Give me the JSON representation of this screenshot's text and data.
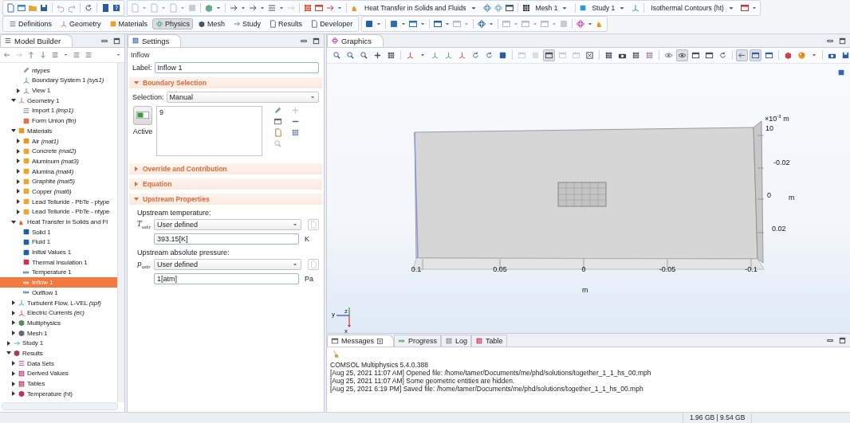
{
  "toolbar": {
    "dropdowns": [
      "Heat Transfer in Solids and Fluids",
      "Mesh 1",
      "Study 1",
      "Isothermal Contours (ht)"
    ]
  },
  "ribbon": {
    "tabs": [
      {
        "label": "Definitions",
        "selected": false
      },
      {
        "label": "Geometry",
        "selected": false
      },
      {
        "label": "Materials",
        "selected": false
      },
      {
        "label": "Physics",
        "selected": true
      },
      {
        "label": "Mesh",
        "selected": false
      },
      {
        "label": "Study",
        "selected": false
      },
      {
        "label": "Results",
        "selected": false
      },
      {
        "label": "Developer",
        "selected": false
      }
    ]
  },
  "model_builder": {
    "title": "Model Builder",
    "tree": [
      {
        "children": [
          {
            "children": [
              {
                "label": "ntypes",
                "kind": "selection",
                "selected": false
              },
              {
                "label": "Boundary System 1 *(sys1)*",
                "kind": "coordinate",
                "selected": false
              },
              {
                "label": "View 1",
                "kind": "view",
                "expanded": false,
                "selected": false
              }
            ]
          },
          {
            "label": "Geometry 1",
            "kind": "geometry",
            "expanded": true,
            "selected": false,
            "children": [
              {
                "label": "Import 1 *(imp1)*",
                "kind": "import",
                "selected": false
              },
              {
                "label": "Form Union *(fin)*",
                "kind": "union",
                "selected": false
              }
            ]
          },
          {
            "label": "Materials",
            "kind": "materials",
            "expanded": true,
            "selected": false,
            "children": [
              {
                "label": "Air *(mat1)*",
                "kind": "materials",
                "expanded": false,
                "selected": false
              },
              {
                "label": "Concrete *(mat2)*",
                "kind": "material",
                "expanded": false,
                "selected": false
              },
              {
                "label": "Aluminum *(mat3)*",
                "kind": "material",
                "expanded": false,
                "selected": false
              },
              {
                "label": "Alumina *(mat4)*",
                "kind": "material",
                "expanded": false,
                "selected": false
              },
              {
                "label": "Graphite *(mat5)*",
                "kind": "material",
                "expanded": false,
                "selected": false
              },
              {
                "label": "Copper *(mat6)*",
                "kind": "material",
                "expanded": false,
                "selected": false
              },
              {
                "label": "Lead Telluride - PbTe - ptype",
                "kind": "material",
                "expanded": false,
                "selected": false
              },
              {
                "label": "Lead Telluride - PbTe - ntype",
                "kind": "material",
                "expanded": false,
                "selected": false
              }
            ]
          },
          {
            "label": "Heat Transfer in Solids and Fl",
            "kind": "physics",
            "expanded": true,
            "selected": false,
            "children": [
              {
                "label": "Solid 1",
                "kind": "domain",
                "selected": false
              },
              {
                "label": "Fluid 1",
                "kind": "domain",
                "selected": false
              },
              {
                "label": "Initial Values 1",
                "kind": "domain",
                "selected": false
              },
              {
                "label": "Thermal Insulation 1",
                "kind": "insulation",
                "selected": false
              },
              {
                "label": "Temperature 1",
                "kind": "boundary",
                "selected": false
              },
              {
                "label": "Inflow 1",
                "kind": "boundary",
                "selected": true
              },
              {
                "label": "Outflow 1",
                "kind": "boundary",
                "selected": false
              }
            ]
          },
          {
            "label": "Turbulent Flow, L-VEL *(spf)*",
            "kind": "flow",
            "expanded": false,
            "selected": false
          },
          {
            "label": "Electric Currents *(ec)*",
            "kind": "electric",
            "expanded": false,
            "selected": false
          },
          {
            "label": "Multiphysics",
            "kind": "multiphysics",
            "expanded": false,
            "selected": false
          },
          {
            "label": "Mesh 1",
            "kind": "mesh",
            "expanded": false,
            "selected": false
          }
        ]
      },
      {
        "label": "Study 1",
        "kind": "study",
        "expanded": false,
        "selected": false
      },
      {
        "label": "Results",
        "kind": "results",
        "expanded": true,
        "selected": false,
        "children": [
          {
            "label": "Data Sets",
            "kind": "datasets",
            "expanded": false,
            "selected": false
          },
          {
            "label": "Derived Values",
            "kind": "derived",
            "expanded": false,
            "selected": false
          },
          {
            "label": "Tables",
            "kind": "tables",
            "expanded": false,
            "selected": false
          },
          {
            "label": "Temperature (ht)",
            "kind": "plot",
            "expanded": false,
            "selected": false
          }
        ]
      }
    ]
  },
  "settings": {
    "title": "Settings",
    "heading": "Inflow",
    "label_caption": "Label:",
    "label_value": "Inflow 1",
    "sections": [
      {
        "title": "Boundary Selection",
        "expanded": true,
        "kind": "selection",
        "selection_caption": "Selection:",
        "selection_value": "Manual",
        "entities": [
          "9"
        ],
        "active_label": "Active"
      },
      {
        "title": "Override and Contribution",
        "expanded": false
      },
      {
        "title": "Equation",
        "expanded": false
      },
      {
        "title": "Upstream Properties",
        "expanded": true,
        "kind": "properties",
        "fields": [
          {
            "caption": "Upstream temperature:",
            "symbol": "*T*$_{ustr}$",
            "method": "User defined",
            "value": "393.15[K]",
            "unit": "K"
          },
          {
            "caption": "Upstream absolute pressure:",
            "symbol": "*p*$_{ustr}$",
            "method": "User defined",
            "value": "1[atm]",
            "unit": "Pa"
          }
        ]
      }
    ]
  },
  "graphics": {
    "title": "Graphics",
    "x_ticks": [
      "0.1",
      "0.05",
      "0",
      "-0.05",
      "-0.1"
    ],
    "x_unit": "m",
    "z_scale": "×10$^{-3}$ m",
    "z_ticks": [
      "10",
      "-0.02",
      "0",
      "0.02"
    ],
    "z_unit": "m",
    "triad": [
      "y",
      "z",
      "x"
    ]
  },
  "messages": {
    "tabs": [
      {
        "label": "Messages",
        "selected": true
      },
      {
        "label": "Progress",
        "selected": false
      },
      {
        "label": "Log",
        "selected": false
      },
      {
        "label": "Table",
        "selected": false
      }
    ],
    "lines": [
      "COMSOL Multiphysics 5.4.0.388",
      "[Aug 25, 2021 11:07 AM] Opened file: /home/tamer/Documents/me/phd/solutions/together_1_1_hs_00.mph",
      "[Aug 25, 2021 11:07 AM] Some geometric entities are hidden.",
      "[Aug 25, 2021 6:19 PM] Saved file: /home/tamer/Documents/me/phd/solutions/together_1_1_hs_00.mph"
    ]
  },
  "status_bar": {
    "memory": "1.96 GB | 9.54 GB"
  }
}
